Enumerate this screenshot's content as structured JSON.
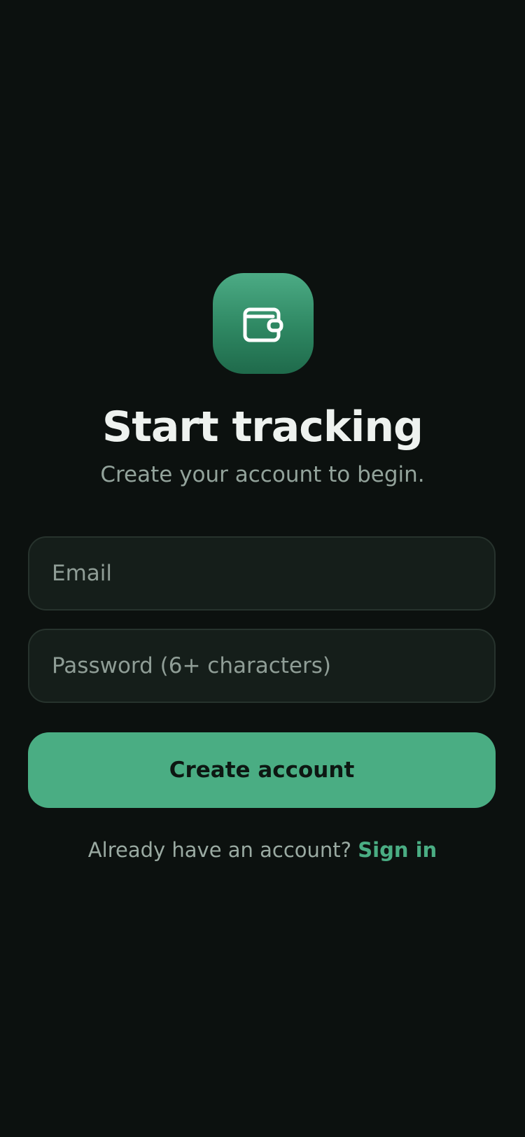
{
  "app_icon": {
    "icon": "wallet-icon",
    "gradient_top": "#4cab85",
    "gradient_bottom": "#1f6a4b"
  },
  "header": {
    "title": "Start tracking",
    "subtitle": "Create your account to begin."
  },
  "form": {
    "email_placeholder": "Email",
    "email_value": "",
    "password_placeholder": "Password (6+ characters)",
    "password_value": "",
    "submit_label": "Create account"
  },
  "footer": {
    "prompt": "Already have an account?",
    "link_label": "Sign in"
  },
  "colors": {
    "background": "#0c110f",
    "accent": "#4aad83",
    "field_background": "#151e1a",
    "field_border": "#27332d"
  }
}
